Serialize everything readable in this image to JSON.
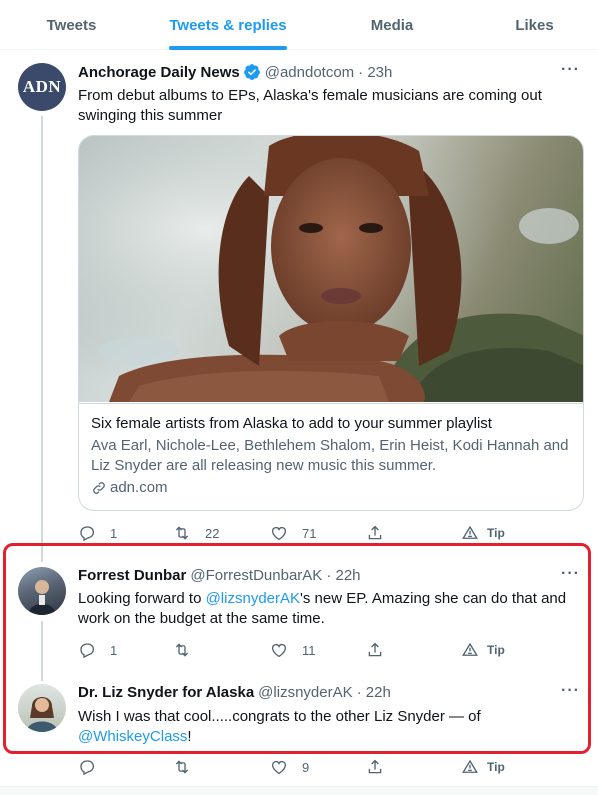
{
  "tabs": [
    {
      "label": "Tweets",
      "active": false
    },
    {
      "label": "Tweets & replies",
      "active": true
    },
    {
      "label": "Media",
      "active": false
    },
    {
      "label": "Likes",
      "active": false
    }
  ],
  "tweets": [
    {
      "avatar_text": "ADN",
      "name": "Anchorage Daily News",
      "verified": true,
      "handle": "@adndotcom",
      "time": "· 23h",
      "more": "···",
      "text": "From debut albums to EPs, Alaska's female musicians are coming out swinging this summer",
      "card": {
        "title": "Six female artists from Alaska to add to your summer playlist",
        "description": "Ava Earl, Nichole-Lee, Bethlehem Shalom, Erin Heist, Kodi Hannah and Liz Snyder are all releasing new music this summer.",
        "domain": "adn.com"
      },
      "actions": {
        "reply": "1",
        "retweet": "22",
        "like": "71",
        "tip": "Tip"
      }
    },
    {
      "name": "Forrest Dunbar",
      "handle": "@ForrestDunbarAK",
      "time": "· 22h",
      "more": "···",
      "text_before": "Looking forward to ",
      "mention": "@lizsnyderAK",
      "text_after": "'s new EP. Amazing she can do that and work on the budget at the same time.",
      "actions": {
        "reply": "1",
        "retweet": "",
        "like": "11",
        "tip": "Tip"
      }
    },
    {
      "name": "Dr. Liz Snyder for Alaska",
      "handle": "@lizsnyderAK",
      "time": "· 22h",
      "more": "···",
      "text_before": "Wish I was that cool.....congrats to the other Liz Snyder — of ",
      "mention": "@WhiskeyClass",
      "text_after": "!",
      "actions": {
        "reply": "",
        "retweet": "",
        "like": "9",
        "tip": "Tip"
      }
    }
  ],
  "colors": {
    "accent": "#1d9bf0",
    "highlight_border": "#e3202e",
    "adn_avatar": "#3b4a6b"
  }
}
